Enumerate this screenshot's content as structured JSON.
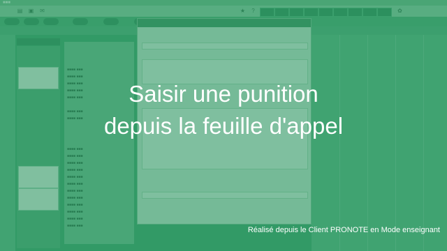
{
  "title": {
    "line1": "Saisir une punition",
    "line2": "depuis la feuille d'appel"
  },
  "caption": "Réalisé depuis le Client PRONOTE en Mode enseignant"
}
